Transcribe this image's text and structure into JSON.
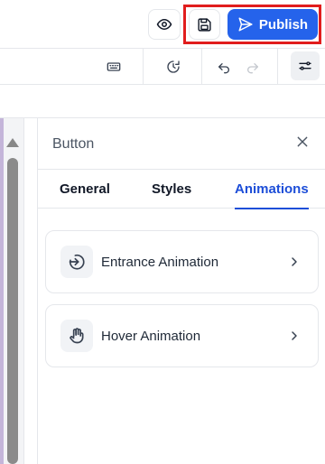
{
  "header": {
    "preview_icon": "eye-icon",
    "save_icon": "floppy-disk-icon",
    "publish_label": "Publish",
    "publish_icon": "send-icon",
    "accent_color": "#2563eb",
    "highlight_color": "#e11d1d"
  },
  "toolbar": {
    "items": [
      {
        "icon": "keyboard-icon"
      },
      {
        "icon": "history-icon"
      },
      {
        "icon": "undo-icon"
      },
      {
        "icon": "redo-icon"
      },
      {
        "icon": "settings-sliders-icon"
      }
    ]
  },
  "panel": {
    "title": "Button",
    "close_icon": "close-icon",
    "tabs": [
      {
        "label": "General",
        "active": false
      },
      {
        "label": "Styles",
        "active": false
      },
      {
        "label": "Animations",
        "active": true
      }
    ],
    "cards": [
      {
        "label": "Entrance Animation",
        "icon": "entrance-icon"
      },
      {
        "label": "Hover Animation",
        "icon": "hand-icon"
      }
    ]
  }
}
